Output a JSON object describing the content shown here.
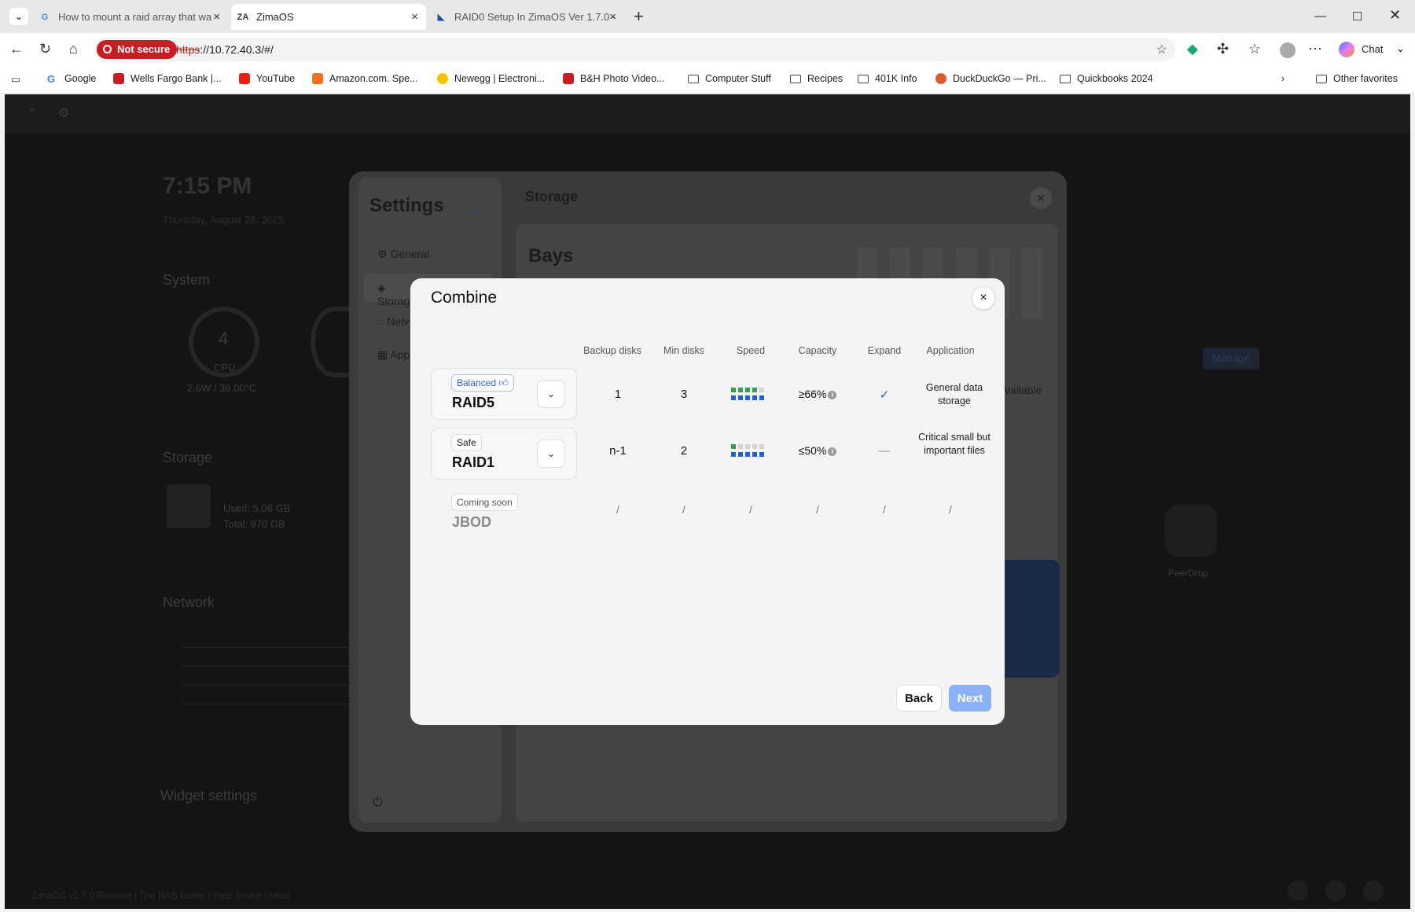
{
  "browser": {
    "tabs": [
      {
        "title": "How to mount a raid array that wa",
        "active": false
      },
      {
        "title": "ZimaOS",
        "active": true
      },
      {
        "title": "RAID0 Setup In ZimaOS Ver 1.7.0 -",
        "active": false
      }
    ],
    "security_label": "Not secure",
    "url_scheme": "https",
    "url_rest": "://10.72.40.3/#/",
    "chat_label": "Chat",
    "bookmarks": [
      "Google",
      "Wells Fargo Bank |...",
      "YouTube",
      "Amazon.com. Spe...",
      "Newegg | Electroni...",
      "B&H Photo Video...",
      "Computer Stuff",
      "Recipes",
      "401K Info",
      "DuckDuckGo — Pri...",
      "Quickbooks 2024"
    ],
    "other_favorites": "Other favorites"
  },
  "background": {
    "time": "7:15 PM",
    "date": "Thursday, August 28, 2025",
    "system_label": "System",
    "cpu_percent": "4",
    "cpu_label": "CPU",
    "cpu_detail": "2.6W / 36.00°C",
    "storage_label": "Storage",
    "storage_used": "Used: 5.06 GB",
    "storage_total": "Total: 970 GB",
    "network_label": "Network",
    "widget_settings": "Widget settings",
    "app_peerdrop": "PeerDrop",
    "footer": "ZimaOS v1.7.0 Release | The NAS Guide | Help Seven | Ideal"
  },
  "settings": {
    "title": "Settings",
    "nav": [
      "General",
      "Storage",
      "Network",
      "Apps"
    ],
    "panel_title": "Storage",
    "bays_title": "Bays",
    "manage": "Manage",
    "available": "vailable"
  },
  "modal": {
    "title": "Combine",
    "columns": [
      "Backup disks",
      "Min disks",
      "Speed",
      "Capacity",
      "Expand",
      "Application"
    ],
    "options": [
      {
        "badge": "Balanced",
        "name": "RAID5",
        "backup_disks": "1",
        "min_disks": "3",
        "speed_level": 4,
        "capacity": "≥66%",
        "expand": "✓",
        "application": "General data storage"
      },
      {
        "badge": "Safe",
        "name": "RAID1",
        "backup_disks": "n-1",
        "min_disks": "2",
        "speed_level": 1,
        "capacity": "≤50%",
        "expand": "—",
        "application": "Critical small but important files"
      },
      {
        "badge": "Coming soon",
        "name": "JBOD",
        "backup_disks": "/",
        "min_disks": "/",
        "speed": "/",
        "capacity": "/",
        "expand": "/",
        "application": "/"
      }
    ],
    "back_label": "Back",
    "next_label": "Next",
    "colors": {
      "accent_blue": "#1f5fd8",
      "speed_green": "#2da24a",
      "next_disabled": "#8ab0f7"
    }
  }
}
